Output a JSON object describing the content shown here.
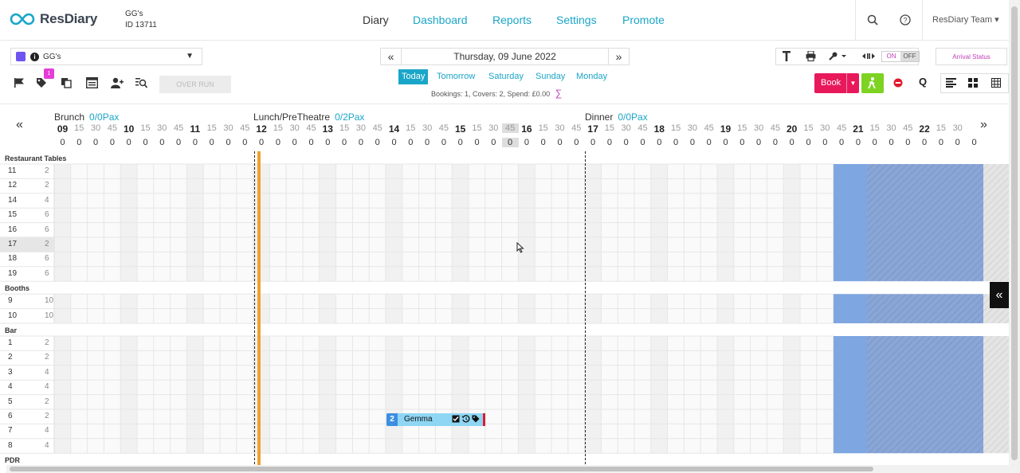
{
  "app": {
    "brand": "ResDiary",
    "venue_name": "GG's",
    "venue_id": "ID 13711"
  },
  "nav": {
    "items": [
      "Diary",
      "Dashboard",
      "Reports",
      "Settings",
      "Promote"
    ],
    "active": "Diary"
  },
  "user": {
    "name": "ResDiary Team"
  },
  "toolbar": {
    "venue_select": "GG's",
    "date": "Thursday, 09 June 2022",
    "quick_days": [
      "Today",
      "Tomorrow",
      "Saturday",
      "Sunday",
      "Monday"
    ],
    "summary": "Bookings: 1, Covers: 2, Spend: £0.00",
    "overrun": "OVER RUN",
    "badge_count": "1",
    "toggle_on": "ON",
    "toggle_off": "OFF",
    "arrival_status": "Arrival Status",
    "book_label": "Book",
    "q_label": "Q"
  },
  "services": [
    {
      "name": "Brunch",
      "pax": "0/0Pax"
    },
    {
      "name": "Lunch/PreTheatre",
      "pax": "0/2Pax"
    },
    {
      "name": "Dinner",
      "pax": "0/0Pax"
    }
  ],
  "timeline": {
    "slots": [
      "09",
      "15",
      "30",
      "45",
      "10",
      "15",
      "30",
      "45",
      "11",
      "15",
      "30",
      "45",
      "12",
      "15",
      "30",
      "45",
      "13",
      "15",
      "30",
      "45",
      "14",
      "15",
      "30",
      "45",
      "15",
      "15",
      "30",
      "45",
      "16",
      "15",
      "30",
      "45",
      "17",
      "15",
      "30",
      "45",
      "18",
      "15",
      "30",
      "45",
      "19",
      "15",
      "30",
      "45",
      "20",
      "15",
      "30",
      "45",
      "21",
      "15",
      "30",
      "45",
      "22",
      "15",
      "30"
    ],
    "covers": [
      "0",
      "0",
      "0",
      "0",
      "0",
      "0",
      "0",
      "0",
      "0",
      "0",
      "0",
      "0",
      "0",
      "0",
      "0",
      "0",
      "0",
      "0",
      "0",
      "0",
      "0",
      "0",
      "0",
      "0",
      "0",
      "0",
      "0",
      "0",
      "0",
      "0",
      "0",
      "0",
      "0",
      "0",
      "0",
      "0",
      "0",
      "0",
      "0",
      "0",
      "0",
      "0",
      "0",
      "0",
      "0",
      "0",
      "0",
      "0",
      "0",
      "0",
      "0",
      "0",
      "0",
      "0",
      "0",
      "0"
    ]
  },
  "sections": [
    {
      "name": "Restaurant Tables",
      "rows": [
        [
          "11",
          "2"
        ],
        [
          "12",
          "2"
        ],
        [
          "14",
          "4"
        ],
        [
          "15",
          "6"
        ],
        [
          "16",
          "6"
        ],
        [
          "17",
          "2"
        ],
        [
          "18",
          "6"
        ],
        [
          "19",
          "6"
        ]
      ]
    },
    {
      "name": "Booths",
      "rows": [
        [
          "9",
          "10"
        ],
        [
          "10",
          "10"
        ]
      ]
    },
    {
      "name": "Bar",
      "rows": [
        [
          "1",
          "2"
        ],
        [
          "2",
          "2"
        ],
        [
          "3",
          "4"
        ],
        [
          "4",
          "4"
        ],
        [
          "5",
          "2"
        ],
        [
          "6",
          "2"
        ],
        [
          "7",
          "4"
        ],
        [
          "8",
          "4"
        ]
      ]
    },
    {
      "name": "PDR",
      "rows": []
    }
  ],
  "booking": {
    "covers": "2",
    "name": "Gemma"
  },
  "colors": {
    "accent": "#1aa6c8",
    "book": "#e8195b",
    "walkin": "#7dd320",
    "now_line": "#f0a030",
    "closed": "#7ea6e0"
  }
}
